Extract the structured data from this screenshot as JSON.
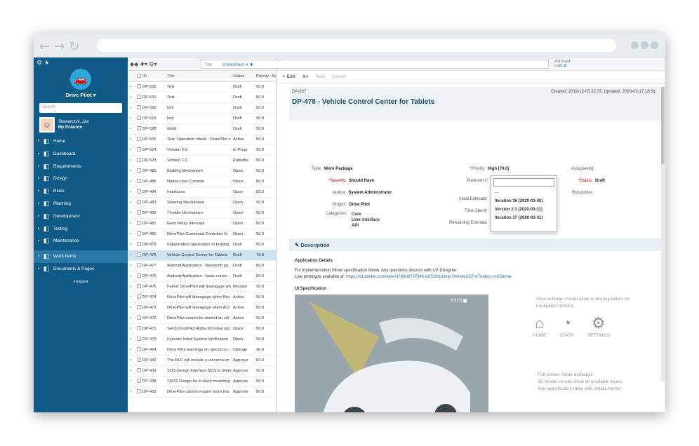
{
  "sidebar": {
    "project": "Drive Pilot ▾",
    "search_placeholder": "Search",
    "user_name": "Stawarczyk, Jan",
    "user_link": "My Polarion",
    "items": [
      {
        "label": "Home",
        "icon": "home-icon"
      },
      {
        "label": "Dashboard",
        "icon": "dashboard-icon"
      },
      {
        "label": "Requirements",
        "icon": "requirements-icon"
      },
      {
        "label": "Design",
        "icon": "design-icon"
      },
      {
        "label": "Risks",
        "icon": "risks-icon"
      },
      {
        "label": "Planning",
        "icon": "planning-icon"
      },
      {
        "label": "Development",
        "icon": "development-icon"
      },
      {
        "label": "Testing",
        "icon": "testing-icon"
      },
      {
        "label": "Maintenance",
        "icon": "maintenance-icon"
      }
    ],
    "items2": [
      {
        "label": "Work Items",
        "icon": "work-items-icon"
      },
      {
        "label": "Documents & Pages",
        "icon": "documents-icon"
      }
    ],
    "expand": "▾ Expand"
  },
  "list": {
    "columns": [
      "ID",
      "Title",
      "Status",
      "Priority",
      "As"
    ],
    "rows": [
      [
        "DP-532",
        "Test",
        "Draft",
        "50.0"
      ],
      [
        "DP-531",
        "Test",
        "Draft",
        "50.0"
      ],
      [
        "DP-530",
        "hhh",
        "Draft",
        "50.0"
      ],
      [
        "DP-529",
        "test",
        "Draft",
        "50.0"
      ],
      [
        "DP-528",
        "dddd",
        "Draft",
        "50.0"
      ],
      [
        "DP-526",
        "Test: Operation check - DrivePilot s",
        "Active",
        "50.0"
      ],
      [
        "DP-524",
        "Version 2.0",
        "In Progr",
        "50.0"
      ],
      [
        "DP-523",
        "Version 1.0",
        "Publishe",
        "50.0"
      ],
      [
        "DP-486",
        "Braking Mechanism",
        "Open",
        "50.0"
      ],
      [
        "DP-485",
        "Native User Console",
        "Open",
        "50.0"
      ],
      [
        "DP-484",
        "Interfaces",
        "Open",
        "50.0"
      ],
      [
        "DP-483",
        "Steering Mechanism",
        "Open",
        "50.0"
      ],
      [
        "DP-482",
        "Throttle Mechanism",
        "Open",
        "50.0"
      ],
      [
        "DP-481",
        "Gear Relay Intercept",
        "Open",
        "50.0"
      ],
      [
        "DP-480",
        "DrivePilot Command Controller fo",
        "Open",
        "50.0"
      ],
      [
        "DP-479",
        "Independent application of braking",
        "Draft",
        "50.0"
      ],
      [
        "DP-478",
        "Vehicle Control Center for Tablets",
        "Draft",
        "70.0"
      ],
      [
        "DP-477",
        "Android Application - Bluetooth pa",
        "Draft",
        "50.0"
      ],
      [
        "DP-476",
        "Android Application - basic contro",
        "Draft",
        "50.0"
      ],
      [
        "DP-475",
        "Failed: DrivePilot will disengage wh",
        "Reopen",
        "50.0"
      ],
      [
        "DP-474",
        "DrivePilot will disengage when Bra",
        "Active",
        "50.0"
      ],
      [
        "DP-473",
        "DrivePilot will disengage when Acc",
        "Active",
        "50.0"
      ],
      [
        "DP-472",
        "DrivePilot cannot be started on vel",
        "Active",
        "50.0"
      ],
      [
        "DP-471",
        "Send DrivePilot Alpha for initial sys",
        "Open",
        "50.0"
      ],
      [
        "DP-470",
        "Execute Initial System Verification",
        "Open",
        "50.0"
      ],
      [
        "DP-454",
        "Drive Pilot warnings on special co",
        "Change",
        "40.0"
      ],
      [
        "DP-440",
        "The BLC will include a universal m",
        "Approve",
        "50.0"
      ],
      [
        "DP-439",
        "SOS Design Interface SOS to Steer",
        "Approve",
        "50.0"
      ],
      [
        "DP-438",
        "TAOS Design for in-dash mounting",
        "Approve",
        "50.0"
      ],
      [
        "DP-433",
        "DrivePilot cannot require more tha",
        "Approve",
        "50.0"
      ]
    ]
  },
  "query": {
    "chip": "Unresolved",
    "found": "260 found",
    "load": "Load all"
  },
  "toolbar": {
    "edit": "Edit",
    "save": "Save",
    "cancel": "Cancel"
  },
  "item": {
    "parent_id": "DP-337",
    "id_title": "DP-478 - Vehicle Control Center for Tablets",
    "created": "Created: 2019-12-05 22:37, Updated: 2020-03-17 18:51",
    "type_label": "Type:",
    "type": "Work Package",
    "severity_label": "*Severity:",
    "severity": "Should Have",
    "author_label": "Author:",
    "author": "System Administrator",
    "project_label": "Project:",
    "project": "Drive Pilot",
    "categories_label": "Categories:",
    "categories": [
      "Core",
      "User Interface",
      "API"
    ],
    "priority_label": "*Priority:",
    "priority": "High (70.0)",
    "planned_label": "Planned In:",
    "planned_value": "--",
    "initial_label": "Initial Estimate:",
    "spent_label": "Time Spent:",
    "remaining_label": "Remaining Estimate:",
    "assignee_label": "Assignee(s):",
    "status_label": "*Status:",
    "status": "Draft",
    "resolution_label": "Resolution:",
    "dropdown_options": [
      "--",
      "Iteration 36 (2020-03-30)",
      "Version 2.1 (2020-03-31)",
      "Iteration 37 (2020-03-31)"
    ]
  },
  "description": {
    "header": "Description",
    "app_details": "Application Details",
    "line1": "For implementation follow specification below. Any questions discuss with UX Designer.",
    "line2": "Live prototype available at:",
    "link": "https://xd.adobe.com/view/a789d8737846-db7d/Mockup-VehicleCCForTablets-vs03brma",
    "spec": "UI Specification",
    "battery": "▾ 91% ▆",
    "note1": "View settings should allow to display labels for navigation buttons.",
    "nav": [
      "HOME",
      "STATS",
      "SETTINGS"
    ],
    "note2a": "Full screen mode activated.",
    "note2b": "3D model should show all available layers.",
    "note2c": "See specification table with details below."
  }
}
